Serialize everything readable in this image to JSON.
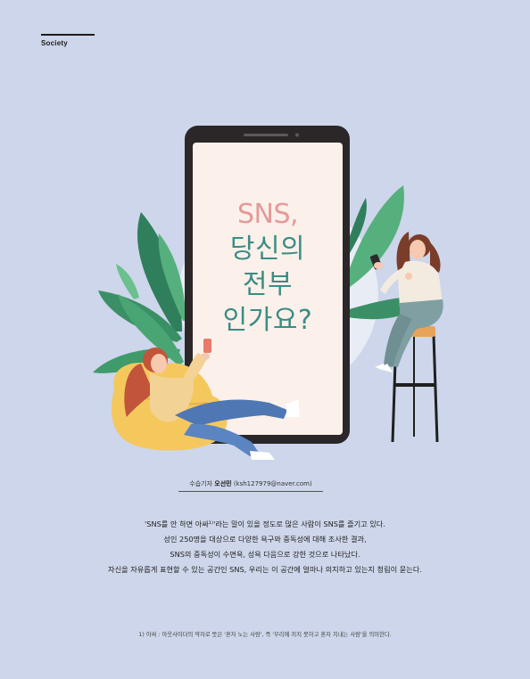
{
  "section": {
    "label": "Society"
  },
  "title": {
    "line1": "SNS,",
    "line2": "당신의",
    "line3": "전부",
    "line4": "인가요?"
  },
  "byline": {
    "role": "수습기자",
    "name": "오선민",
    "email": "(ksh127979@naver.com)"
  },
  "intro": {
    "line1": "'SNS를 안 하면 아싸¹⁾'라는 말이 있을 정도로 많은 사람이 SNS를 즐기고 있다.",
    "line2": "성인 250명을 대상으로 다양한 욕구와 중독성에 대해 조사한 결과,",
    "line3": "SNS의 중독성이 수면욕, 성욕 다음으로 강한 것으로 나타났다.",
    "line4": "자신을 자유롭게 표현할 수 있는 공간인 SNS, 우리는 이 공간에 얼마나 의지하고 있는지 청림이 묻는다."
  },
  "footnote": {
    "text": "1) 아싸 : 아웃사이더의 약자로 뜻은 '혼자 노는 사람', 즉 '무리에 끼지 못하고 혼자 지내는 사람'을 의미한다."
  },
  "colors": {
    "background": "#cdd6ea",
    "title_en": "#e49a9a",
    "title_ko": "#3a8d84",
    "phone_body": "#2b2728",
    "phone_screen": "#fbf1ea"
  }
}
